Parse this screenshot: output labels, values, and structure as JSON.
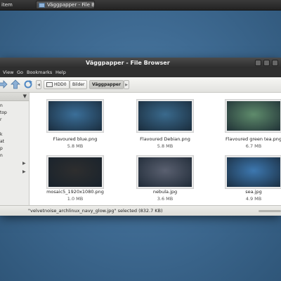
{
  "panel": {
    "system_label": "item",
    "task_label": "Väggpapper - File Bro..."
  },
  "window": {
    "title": "Väggpapper - File Browser"
  },
  "menu": [
    "View",
    "Go",
    "Bookmarks",
    "Help"
  ],
  "breadcrumbs": [
    "HDD0",
    "Bilder",
    "Väggpapper"
  ],
  "sidebar": {
    "items": [
      "n",
      "top",
      "r",
      "k",
      "at",
      "p",
      "n"
    ]
  },
  "files": [
    {
      "name": "Flavoured blue.png",
      "size": "5.8 MB",
      "color": "#3b6f99"
    },
    {
      "name": "Flavoured Debian.png",
      "size": "5.8 MB",
      "color": "#3a6a8d"
    },
    {
      "name": "Flavoured green tea.png",
      "size": "6.7 MB",
      "color": "#5f8c6c"
    },
    {
      "name": "mosaic5_1920x1080.png",
      "size": "1.0 MB",
      "color": "#2e2e2e"
    },
    {
      "name": "nebula.jpg",
      "size": "3.6 MB",
      "color": "#5a6070"
    },
    {
      "name": "sea.jpg",
      "size": "4.9 MB",
      "color": "#3d78b0"
    }
  ],
  "status": {
    "text": "\"velvetnoise_archlinux_navy_glow.jpg\" selected (832.7 KB)"
  },
  "colors": {
    "desktop": "#3f6b93",
    "titlebar": "#3a3a3a",
    "menubar": "#2f2f2f"
  }
}
